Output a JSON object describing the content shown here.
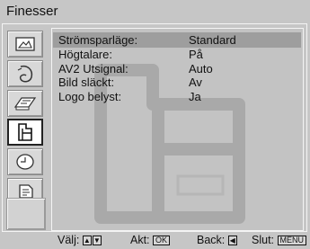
{
  "menu": {
    "title": "Finesser"
  },
  "sidebar": {
    "items": [
      {
        "icon": "picture-icon",
        "active": false
      },
      {
        "icon": "sound-icon",
        "active": false
      },
      {
        "icon": "screen-control-icon",
        "active": false
      },
      {
        "icon": "features-icon",
        "active": true
      },
      {
        "icon": "setup-icon",
        "active": false
      },
      {
        "icon": "pc-settings-icon",
        "active": false
      }
    ]
  },
  "settings": [
    {
      "label": "Strömsparläge:",
      "value": "Standard"
    },
    {
      "label": "Högtalare:",
      "value": "På"
    },
    {
      "label": "AV2 Utsignal:",
      "value": "Auto"
    },
    {
      "label": "Bild släckt:",
      "value": "Av"
    },
    {
      "label": "Logo belyst:",
      "value": "Ja"
    }
  ],
  "footer": {
    "select_label": "Välj:",
    "set_label": "Akt:",
    "set_key": "OK",
    "back_label": "Back:",
    "exit_label": "Slut:",
    "exit_key": "MENU"
  }
}
